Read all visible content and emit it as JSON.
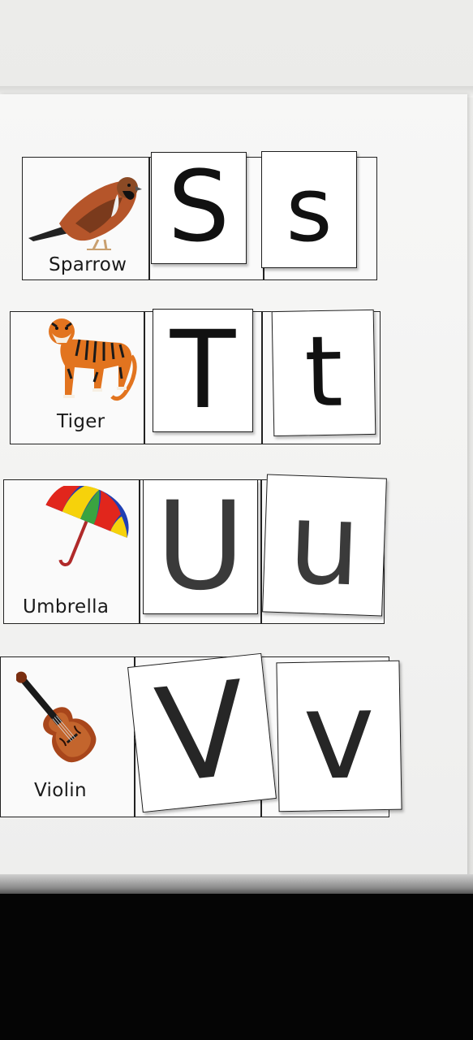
{
  "rows": [
    {
      "word": "Sparrow",
      "icon": "sparrow-icon",
      "upper": "S",
      "lower": "s"
    },
    {
      "word": "Tiger",
      "icon": "tiger-icon",
      "upper": "T",
      "lower": "t"
    },
    {
      "word": "Umbrella",
      "icon": "umbrella-icon",
      "upper": "U",
      "lower": "u"
    },
    {
      "word": "Violin",
      "icon": "violin-icon",
      "upper": "V",
      "lower": "v"
    }
  ]
}
